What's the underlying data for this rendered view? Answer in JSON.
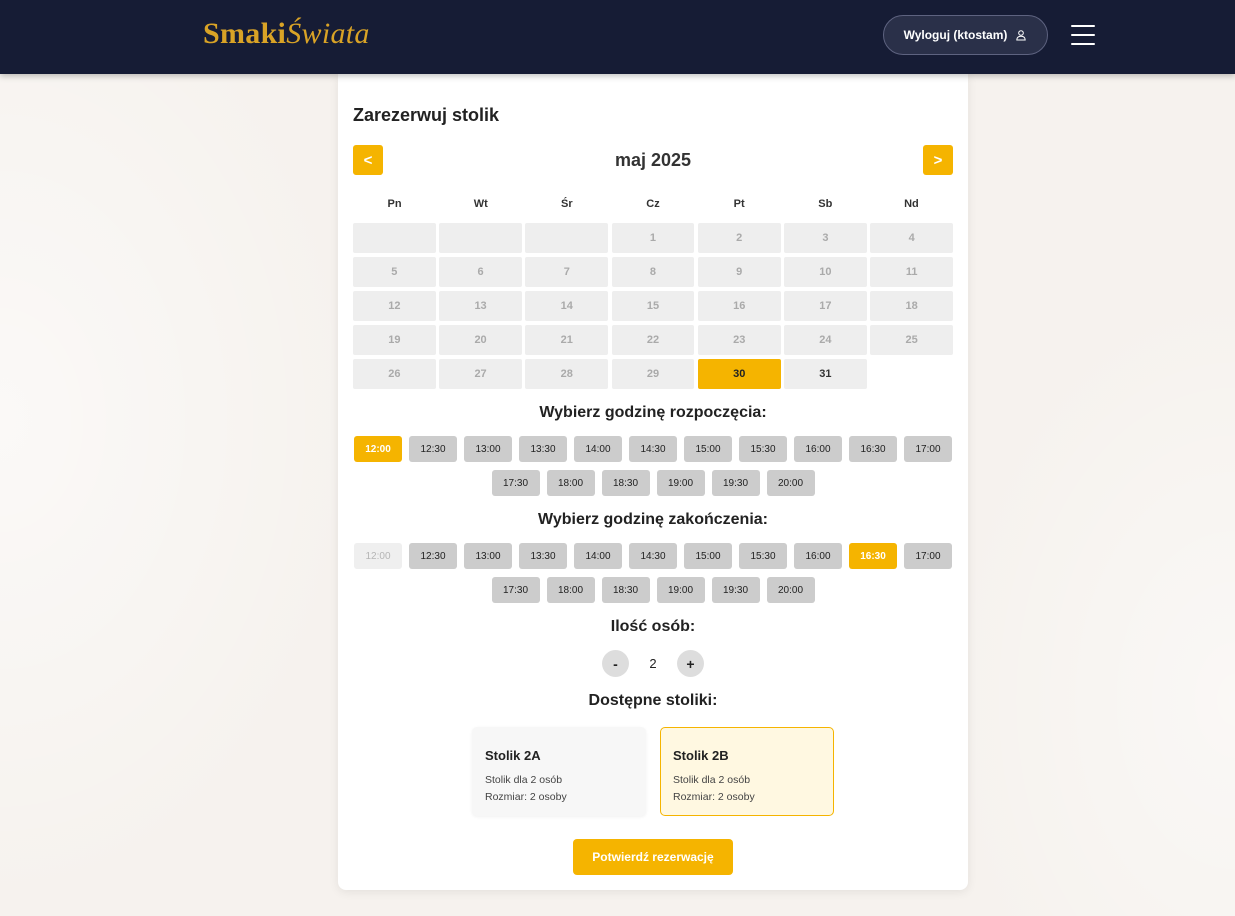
{
  "header": {
    "logo_part1": "Smaki",
    "logo_part2": "Świata",
    "logout_label": "Wyloguj (ktostam)",
    "logout_icon": "user-icon",
    "menu_icon": "hamburger-menu-icon"
  },
  "colors": {
    "header_bg": "#161c35",
    "accent": "#f5b400",
    "logo": "#d9a326"
  },
  "reservation": {
    "title": "Zarezerwuj stolik",
    "prev_label": "<",
    "next_label": ">",
    "month": "maj 2025",
    "weekdays": [
      "Pn",
      "Wt",
      "Śr",
      "Cz",
      "Pt",
      "Sb",
      "Nd"
    ],
    "leading_blank_days": 3,
    "days_in_month": 31,
    "selected_day": 30,
    "available_days": [
      30,
      31
    ],
    "start_title": "Wybierz godzinę rozpoczęcia:",
    "start_times": [
      "12:00",
      "12:30",
      "13:00",
      "13:30",
      "14:00",
      "14:30",
      "15:00",
      "15:30",
      "16:00",
      "16:30",
      "17:00",
      "17:30",
      "18:00",
      "18:30",
      "19:00",
      "19:30",
      "20:00"
    ],
    "start_selected": "12:00",
    "end_title": "Wybierz godzinę zakończenia:",
    "end_times": [
      "12:00",
      "12:30",
      "13:00",
      "13:30",
      "14:00",
      "14:30",
      "15:00",
      "15:30",
      "16:00",
      "16:30",
      "17:00",
      "17:30",
      "18:00",
      "18:30",
      "19:00",
      "19:30",
      "20:00"
    ],
    "end_selected": "16:30",
    "end_disabled": [
      "12:00"
    ],
    "people_title": "Ilość osób:",
    "minus_label": "-",
    "plus_label": "+",
    "people_count": "2",
    "tables_title": "Dostępne stoliki:",
    "tables": [
      {
        "name": "Stolik 2A",
        "desc": "Stolik dla 2 osób",
        "size": "Rozmiar: 2 osoby",
        "selected": false
      },
      {
        "name": "Stolik 2B",
        "desc": "Stolik dla 2 osób",
        "size": "Rozmiar: 2 osoby",
        "selected": true
      }
    ],
    "confirm_label": "Potwierdź rezerwację"
  }
}
